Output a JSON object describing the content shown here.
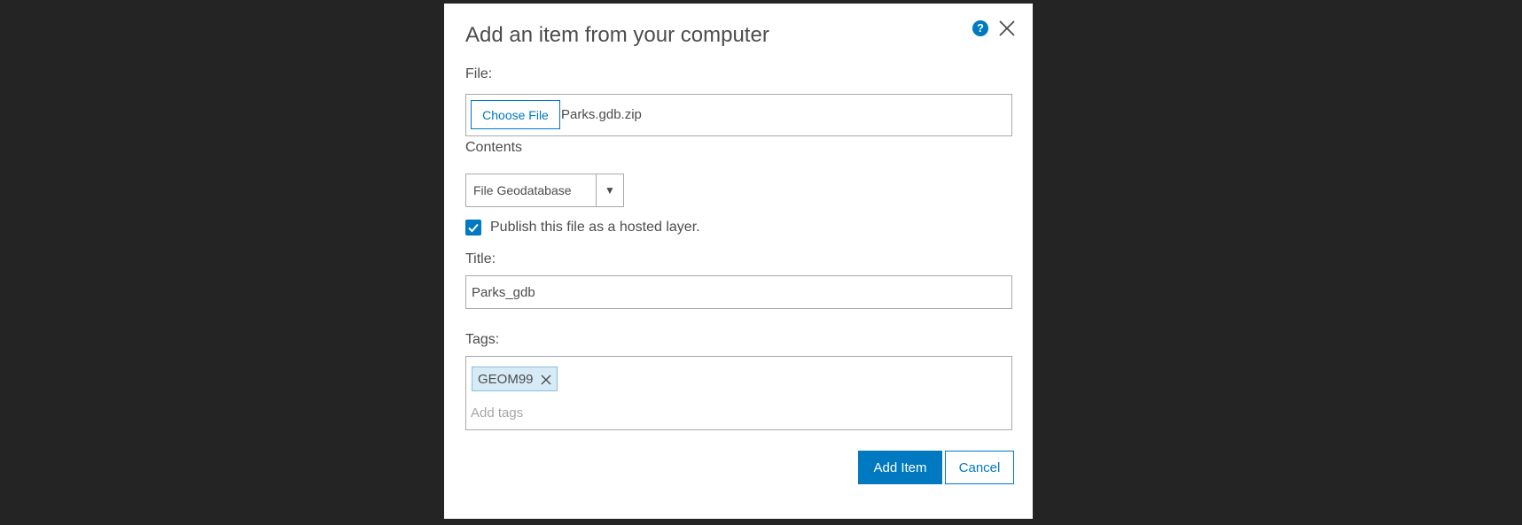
{
  "dialog": {
    "title": "Add an item from your computer",
    "help_icon": "question-circle-icon",
    "close_icon": "close-icon"
  },
  "file": {
    "label": "File:",
    "choose_button": "Choose File",
    "file_name": "Parks.gdb.zip"
  },
  "contents": {
    "label": "Contents",
    "selected": "File Geodatabase",
    "arrow": "▼"
  },
  "publish": {
    "checked": true,
    "label": "Publish this file as a hosted layer."
  },
  "title_field": {
    "label": "Title:",
    "value": "Parks_gdb"
  },
  "tags": {
    "label": "Tags:",
    "items": [
      "GEOM99"
    ],
    "placeholder": "Add tags"
  },
  "actions": {
    "add_item": "Add Item",
    "cancel": "Cancel"
  },
  "colors": {
    "accent": "#0079c1",
    "backdrop": "#242424",
    "tag_bg": "#d7ebf7"
  }
}
